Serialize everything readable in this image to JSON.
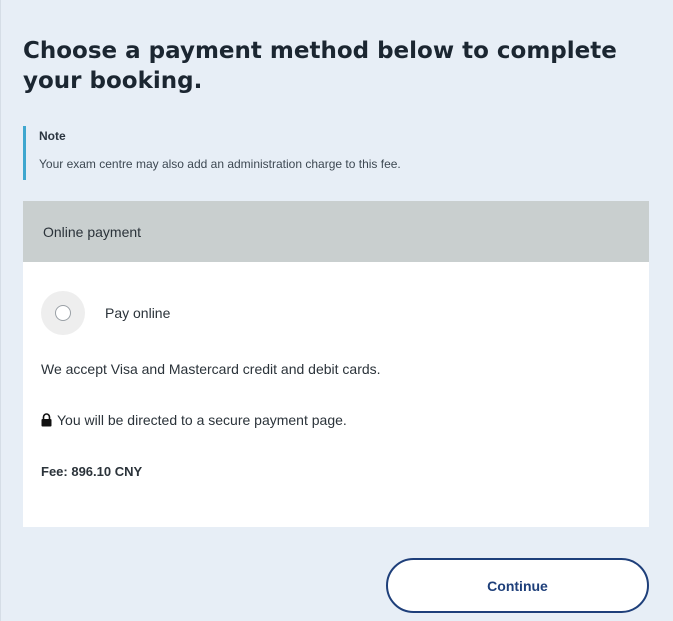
{
  "heading": "Choose a payment method below to complete your booking.",
  "note": {
    "label": "Note",
    "text": "Your exam centre may also add an administration charge to this fee."
  },
  "payment_panel": {
    "header": "Online payment",
    "option_label": "Pay online",
    "option_selected": false,
    "accept_text": "We accept Visa and Mastercard credit and debit cards.",
    "secure_text": "You will be directed to a secure payment page.",
    "fee_text": "Fee: 896.10 CNY"
  },
  "continue_label": "Continue",
  "colors": {
    "background": "#e7eef6",
    "note_accent": "#3fa7cf",
    "panel_header": "#c9cfcf",
    "button_border": "#1e3f7a"
  },
  "icons": {
    "lock": "lock-icon",
    "radio": "radio-button"
  }
}
